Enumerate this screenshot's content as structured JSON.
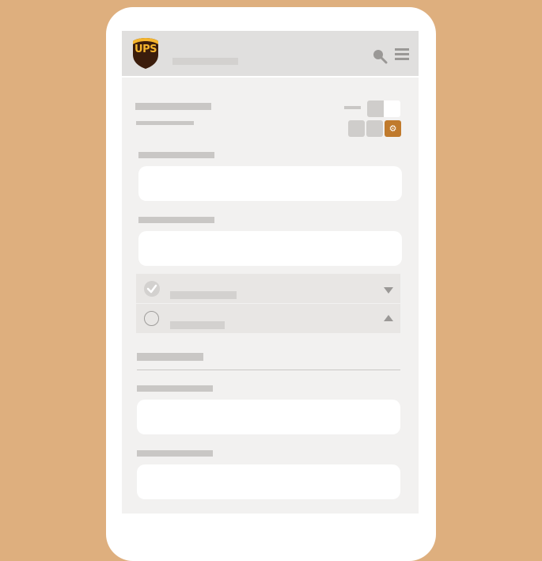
{
  "app": {
    "brand": "UPS"
  },
  "colors": {
    "background": "#deaf7e",
    "accent": "#c07a2c",
    "logo_gold": "#f5b52e",
    "logo_brown": "#3b1d0c"
  },
  "icons": {
    "search": "search-icon",
    "menu": "hamburger-menu-icon",
    "settings": "gear-icon",
    "check": "checkmark-icon",
    "expand": "chevron-down-icon",
    "collapse": "chevron-up-icon"
  },
  "accordion": {
    "items": [
      {
        "state": "completed",
        "expanded": false
      },
      {
        "state": "pending",
        "expanded": true
      }
    ]
  }
}
